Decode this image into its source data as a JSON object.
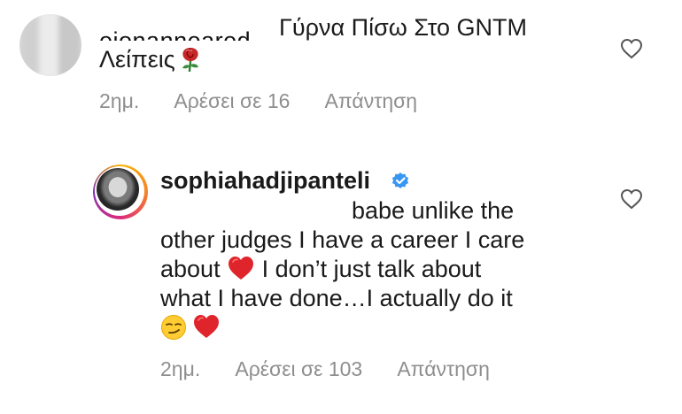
{
  "comments": [
    {
      "username_fragment": "eionanneared",
      "text_line1": "Γύρνα Πίσω Στο GNTM",
      "text_line2": "Λείπεις",
      "text_line2_emoji": "rose-emoji",
      "time": "2ημ.",
      "likes": "Αρέσει σε 16",
      "reply": "Απάντηση",
      "like_icon": "heart-outline-icon"
    },
    {
      "username": "sophiahadjipanteli",
      "verified": true,
      "text_lines": [
        "babe unlike the",
        "other judges I have a career I care",
        "about",
        "I don’t just talk about",
        "what I have done…I actually do it"
      ],
      "emojis": [
        "red-heart-emoji",
        "smirking-face-emoji"
      ],
      "time": "2ημ.",
      "likes": "Αρέσει σε 103",
      "reply": "Απάντηση",
      "like_icon": "heart-outline-icon"
    }
  ],
  "colors": {
    "text": "#1a1a1a",
    "meta": "#8e8e8e",
    "verified": "#3897f0",
    "heart_emoji": "#e0242b"
  }
}
